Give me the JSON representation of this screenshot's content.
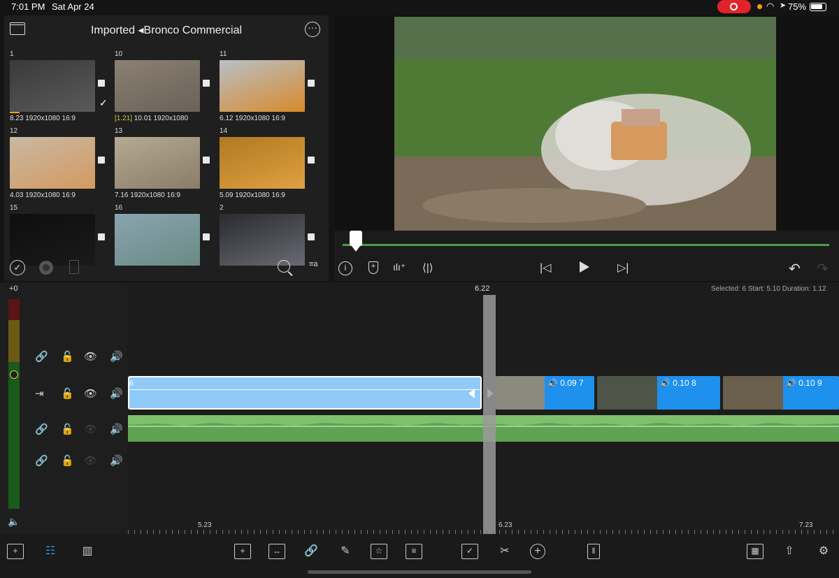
{
  "status_bar": {
    "time": "7:01 PM",
    "date": "Sat Apr 24",
    "battery": "75%"
  },
  "browser": {
    "title": "Imported ◂Bronco Commercial",
    "clips": [
      {
        "num": "1",
        "meta_pre": "",
        "meta": "8.23  1920x1080  16:9",
        "checked": true,
        "colors": [
          "#3a3a3a",
          "#5a5a5a"
        ]
      },
      {
        "num": "10",
        "meta_pre": "[1.21]",
        "meta": "  10.01  1920x1080",
        "checked": false,
        "colors": [
          "#8a8072",
          "#6a6258"
        ]
      },
      {
        "num": "11",
        "meta_pre": "",
        "meta": "6.12  1920x1080  16:9",
        "checked": false,
        "colors": [
          "#b8c0c8",
          "#d88a2a"
        ]
      },
      {
        "num": "12",
        "meta_pre": "",
        "meta": "4.03  1920x1080  16:9",
        "checked": false,
        "colors": [
          "#c8b8a2",
          "#d49a60"
        ]
      },
      {
        "num": "13",
        "meta_pre": "",
        "meta": "7.16  1920x1080  16:9",
        "checked": false,
        "colors": [
          "#b6aa94",
          "#8a7c66"
        ]
      },
      {
        "num": "14",
        "meta_pre": "",
        "meta": "5.09  1920x1080  16:9",
        "checked": false,
        "colors": [
          "#b07a22",
          "#e0a040"
        ]
      },
      {
        "num": "15",
        "meta_pre": "",
        "meta": "",
        "checked": false,
        "colors": [
          "#0e0e0e",
          "#1a1a1a"
        ]
      },
      {
        "num": "16",
        "meta_pre": "",
        "meta": "",
        "checked": false,
        "colors": [
          "#8aa4b0",
          "#6a8a84"
        ]
      },
      {
        "num": "2",
        "meta_pre": "",
        "meta": "",
        "checked": false,
        "colors": [
          "#2a2a30",
          "#6a6a74"
        ]
      }
    ]
  },
  "timeline": {
    "meter_label": "+0",
    "selected_info": "Selected: 6  Start: 5.10  Duration: 1.12",
    "playhead_time": "6.22",
    "main_clip_label": "6",
    "clips": [
      {
        "tag": "🔊 0.09   7"
      },
      {
        "tag": "🔊 0.10   8"
      },
      {
        "tag": "🔊 0.10   9"
      }
    ],
    "ruler": [
      "5.23",
      "6.23",
      "7.23"
    ]
  },
  "colors": {
    "clip_blue": "#1e90ee",
    "selected_clip": "#8fcaf8",
    "audio_green": "#7dc06e",
    "accent_red": "#e0242b"
  }
}
